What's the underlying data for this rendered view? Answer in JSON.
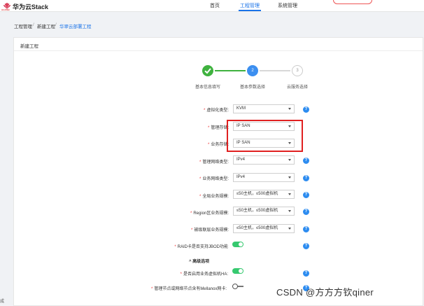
{
  "header": {
    "brand": "华为云Stack",
    "brand_sub": "HUAWEI",
    "nav": [
      {
        "label": "首页"
      },
      {
        "label": "工程管理"
      },
      {
        "label": "系统管理"
      }
    ]
  },
  "breadcrumb": [
    "工程管理",
    "新建工程",
    "华翠云部署工程"
  ],
  "card": {
    "title": "新建工程"
  },
  "steps": [
    {
      "number": "",
      "label": "基本信息填写",
      "state": "done"
    },
    {
      "number": "2",
      "label": "基本参数选择",
      "state": "active"
    },
    {
      "number": "3",
      "label": "云服务选择",
      "state": "todo"
    }
  ],
  "fields": [
    {
      "label": "虚拟化类型:",
      "value": "KVM"
    },
    {
      "label": "管理存储:",
      "value": "IP SAN"
    },
    {
      "label": "业务存储:",
      "value": "IP SAN"
    },
    {
      "label": "管理网络类型:",
      "value": "IPv4"
    },
    {
      "label": "业务网络类型:",
      "value": "IPv4"
    },
    {
      "label": "全局业务规模:",
      "value": "≤50主机，≤500虚拟机"
    },
    {
      "label": "Region区业务规模:",
      "value": "≤50主机，≤500虚拟机"
    },
    {
      "label": "被级联层业务规模:",
      "value": "≤50主机，≤500虚拟机"
    }
  ],
  "toggles": {
    "raid_label": "RAID卡是否支持JBOD功能",
    "raid_on": true,
    "advanced_title": "高级选项",
    "ha_label": "是否启用业务虚拟机HA:",
    "ha_on": true,
    "mellanox_label": "管理节点或网络节点含有Mellanox网卡:",
    "mellanox_on": false
  },
  "help_glyph": "?",
  "status_text": "成",
  "watermark": "CSDN @方方方钦qiner",
  "colors": {
    "primary": "#3c8ff0",
    "done": "#3fb23f",
    "toggle_on": "#36c96f",
    "highlight": "#e02020"
  }
}
